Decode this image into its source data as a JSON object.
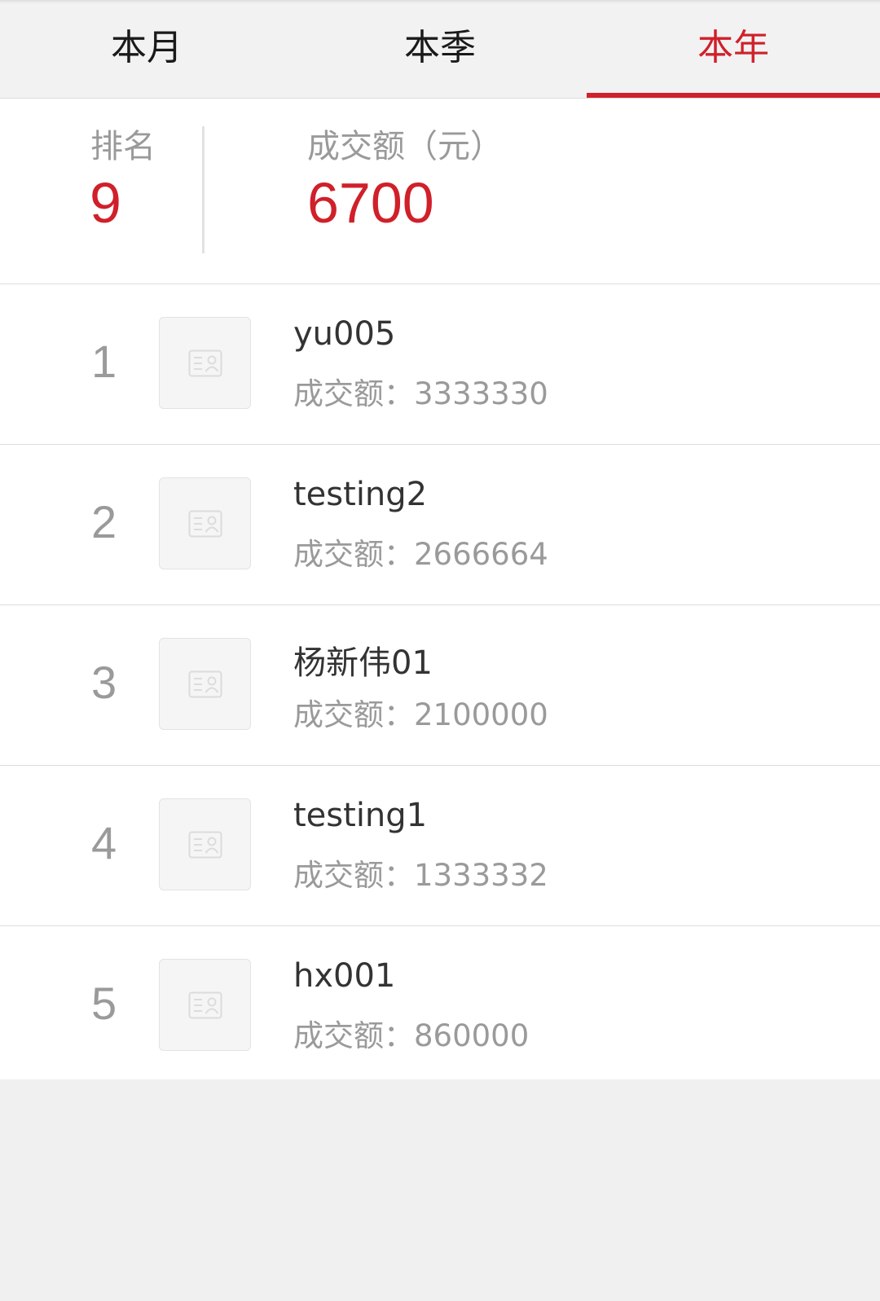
{
  "tabs": [
    {
      "label": "本月",
      "active": false
    },
    {
      "label": "本季",
      "active": false
    },
    {
      "label": "本年",
      "active": true
    }
  ],
  "summary": {
    "rank_label": "排名",
    "rank_value": "9",
    "amount_label": "成交额（元）",
    "amount_value": "6700"
  },
  "leaderboard": [
    {
      "rank": "1",
      "name": "yu005",
      "amount": "成交额：3333330"
    },
    {
      "rank": "2",
      "name": "testing2",
      "amount": "成交额：2666664"
    },
    {
      "rank": "3",
      "name": "杨新伟01",
      "amount": "成交额：2100000"
    },
    {
      "rank": "4",
      "name": "testing1",
      "amount": "成交额：1333332"
    },
    {
      "rank": "5",
      "name": "hx001",
      "amount": "成交额：860000"
    }
  ],
  "colors": {
    "accent": "#d0202a",
    "muted": "#9a9a9a",
    "background": "#f0f0f0"
  }
}
